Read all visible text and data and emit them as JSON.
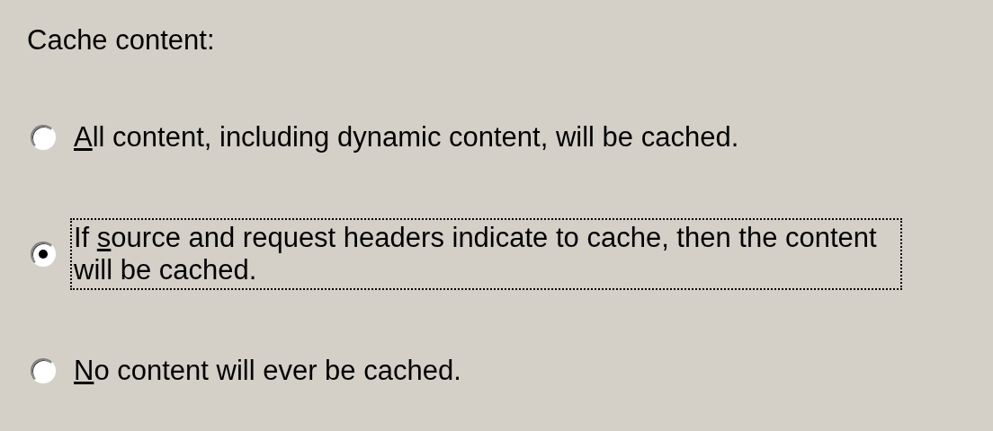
{
  "group": {
    "label": "Cache content:"
  },
  "options": [
    {
      "label": [
        {
          "text": "A",
          "underlined": true
        },
        {
          "text": "ll content, including dynamic content, will be cached.",
          "underlined": false
        }
      ],
      "selected": false,
      "focused": false
    },
    {
      "label": [
        {
          "text": "If ",
          "underlined": false
        },
        {
          "text": "s",
          "underlined": true
        },
        {
          "text": "ource and request headers indicate to cache, then the content will be cached.",
          "underlined": false
        }
      ],
      "selected": true,
      "focused": true
    },
    {
      "label": [
        {
          "text": "N",
          "underlined": true
        },
        {
          "text": "o content will ever be cached.",
          "underlined": false
        }
      ],
      "selected": false,
      "focused": false
    }
  ]
}
